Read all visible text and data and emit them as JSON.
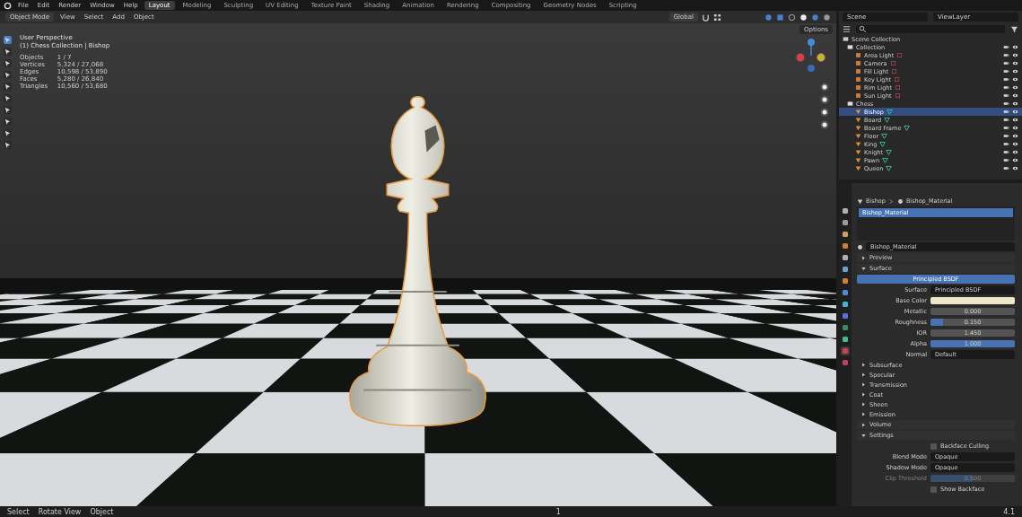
{
  "top_bar": {
    "menus": [
      "File",
      "Edit",
      "Render",
      "Window",
      "Help"
    ],
    "workspaces": [
      {
        "label": "Layout",
        "selected": true
      },
      {
        "label": "Modeling",
        "selected": false
      },
      {
        "label": "Sculpting",
        "selected": false
      },
      {
        "label": "UV Editing",
        "selected": false
      },
      {
        "label": "Texture Paint",
        "selected": false
      },
      {
        "label": "Shading",
        "selected": false
      },
      {
        "label": "Animation",
        "selected": false
      },
      {
        "label": "Rendering",
        "selected": false
      },
      {
        "label": "Compositing",
        "selected": false
      },
      {
        "label": "Geometry Nodes",
        "selected": false
      },
      {
        "label": "Scripting",
        "selected": false
      }
    ]
  },
  "viewport": {
    "mode": "Object Mode",
    "menus": [
      "View",
      "Select",
      "Add",
      "Object"
    ],
    "orientation": "Global",
    "options": "Options",
    "overlay_title": "User Perspective",
    "overlay_subtitle": "(1) Chess Collection | Bishop",
    "stats": [
      {
        "label": "Objects",
        "value": "1 / 7"
      },
      {
        "label": "Vertices",
        "value": "5,324 / 27,068"
      },
      {
        "label": "Edges",
        "value": "10,598 / 53,890"
      },
      {
        "label": "Faces",
        "value": "5,280 / 26,840"
      },
      {
        "label": "Triangles",
        "value": "10,560 / 53,680"
      }
    ]
  },
  "outliner": {
    "scene": "Scene",
    "view_layer": "ViewLayer",
    "root": "Scene Collection",
    "items": [
      {
        "name": "Collection",
        "kind": "collection",
        "selected": false,
        "children": [
          {
            "name": "Area Light",
            "kind": "light",
            "selected": false
          },
          {
            "name": "Camera",
            "kind": "light",
            "selected": false
          },
          {
            "name": "Fill Light",
            "kind": "light",
            "selected": false
          },
          {
            "name": "Key Light",
            "kind": "light",
            "selected": false
          },
          {
            "name": "Rim Light",
            "kind": "light",
            "selected": false
          },
          {
            "name": "Sun Light",
            "kind": "light",
            "selected": false
          }
        ]
      },
      {
        "name": "Chess",
        "kind": "collection",
        "selected": false,
        "children": [
          {
            "name": "Bishop",
            "kind": "mesh",
            "selected": true
          },
          {
            "name": "Board",
            "kind": "mesh",
            "selected": false
          },
          {
            "name": "Board Frame",
            "kind": "mesh",
            "selected": false
          },
          {
            "name": "Floor",
            "kind": "mesh",
            "selected": false
          },
          {
            "name": "King",
            "kind": "mesh",
            "selected": false
          },
          {
            "name": "Knight",
            "kind": "mesh",
            "selected": false
          },
          {
            "name": "Pawn",
            "kind": "mesh",
            "selected": false
          },
          {
            "name": "Queen",
            "kind": "mesh",
            "selected": false
          }
        ]
      }
    ]
  },
  "properties": {
    "tabs": [
      {
        "selected": false
      },
      {
        "selected": false
      },
      {
        "selected": false
      },
      {
        "selected": false
      },
      {
        "selected": false
      },
      {
        "selected": false
      },
      {
        "selected": false
      },
      {
        "selected": false
      },
      {
        "selected": false
      },
      {
        "selected": false
      },
      {
        "selected": false
      },
      {
        "selected": false
      },
      {
        "selected": true
      },
      {
        "selected": false
      }
    ],
    "breadcrumb": [
      "Bishop",
      "Bishop_Material"
    ],
    "slots": [
      {
        "name": "Bishop_Material",
        "selected": true
      }
    ],
    "material_name": "Bishop_Material",
    "panels": [
      {
        "title": "Preview",
        "expanded": false
      },
      {
        "title": "Surface",
        "expanded": true
      }
    ],
    "surface_button": "Principled BSDF",
    "fields": [
      {
        "label": "Surface",
        "kind": "link",
        "value": "Principled BSDF"
      },
      {
        "label": "Base Color",
        "kind": "color",
        "color": "#efe8c8"
      },
      {
        "label": "Metallic",
        "kind": "number",
        "value": "0.000"
      },
      {
        "label": "Roughness",
        "kind": "slider",
        "value": "0.150",
        "level": 0.15
      },
      {
        "label": "IOR",
        "kind": "number",
        "value": "1.450"
      },
      {
        "label": "Alpha",
        "kind": "slider",
        "value": "1.000",
        "level": 1
      },
      {
        "label": "Normal",
        "kind": "link",
        "value": "Default"
      }
    ],
    "subpanels": [
      "Subsurface",
      "Specular",
      "Transmission",
      "Coat",
      "Sheen",
      "Emission"
    ],
    "more_panels": [
      {
        "title": "Volume",
        "expanded": false
      },
      {
        "title": "Settings",
        "expanded": true
      }
    ],
    "settings": [
      {
        "kind": "checkbox",
        "label": "Backface Culling",
        "checked": false
      },
      {
        "kind": "dropdown",
        "label": "Blend Mode",
        "value": "Opaque"
      },
      {
        "kind": "dropdown",
        "label": "Shadow Mode",
        "value": "Opaque"
      },
      {
        "kind": "slider",
        "label": "Clip Threshold",
        "value": "0.500",
        "level": 0.5,
        "disabled": true
      },
      {
        "kind": "checkbox",
        "label": "Show Backface",
        "checked": false
      }
    ]
  },
  "status_bar": {
    "hints": [
      "Select",
      "Rotate View",
      "Object"
    ],
    "frame": "1",
    "version": "4.1"
  }
}
